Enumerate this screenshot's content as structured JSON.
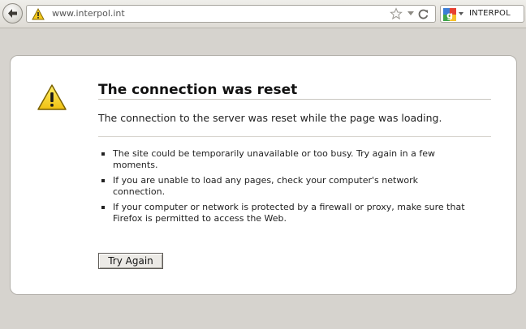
{
  "browser": {
    "url": "www.interpol.int",
    "search_text": "INTERPOL",
    "icons": {
      "back": "back-arrow-icon",
      "site_warning": "warning-icon",
      "bookmark": "star-icon",
      "history_dropdown": "chevron-down-icon",
      "reload": "reload-icon",
      "search_engine": "google-icon"
    }
  },
  "error_page": {
    "title": "The connection was reset",
    "description": "The connection to the server was reset while the page was loading.",
    "reasons": [
      "The site could be temporarily unavailable or too busy. Try again in a few moments.",
      "If you are unable to load any pages, check your computer's network connection.",
      "If your computer or network is protected by a firewall or proxy, make sure that Firefox is permitted to access the Web."
    ],
    "try_again_label": "Try Again",
    "icon": "warning-triangle-icon",
    "accent_color": "#f5d328"
  }
}
